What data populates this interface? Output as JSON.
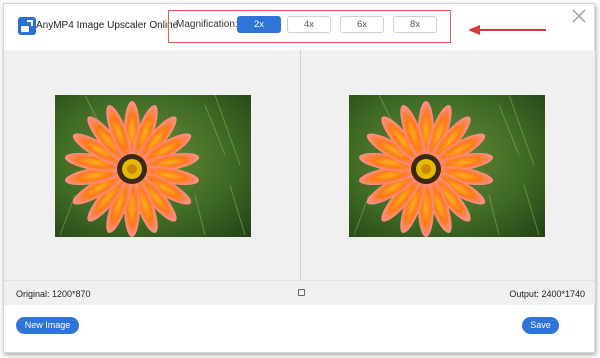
{
  "header": {
    "app_title": "AnyMP4 Image Upscaler Online",
    "magnification_label": "Magnification:",
    "options": [
      "2x",
      "4x",
      "6x",
      "8x"
    ],
    "selected": "2x"
  },
  "info": {
    "original": "Original: 1200*870",
    "output": "Output: 2400*1740"
  },
  "footer": {
    "new_image": "New Image",
    "save": "Save"
  },
  "colors": {
    "accent": "#2f74d8",
    "highlight_box": "#e05a5a",
    "arrow": "#d63b3b"
  },
  "icons": [
    "app-logo-icon",
    "close-icon",
    "compare-icon",
    "arrow-annotation"
  ]
}
